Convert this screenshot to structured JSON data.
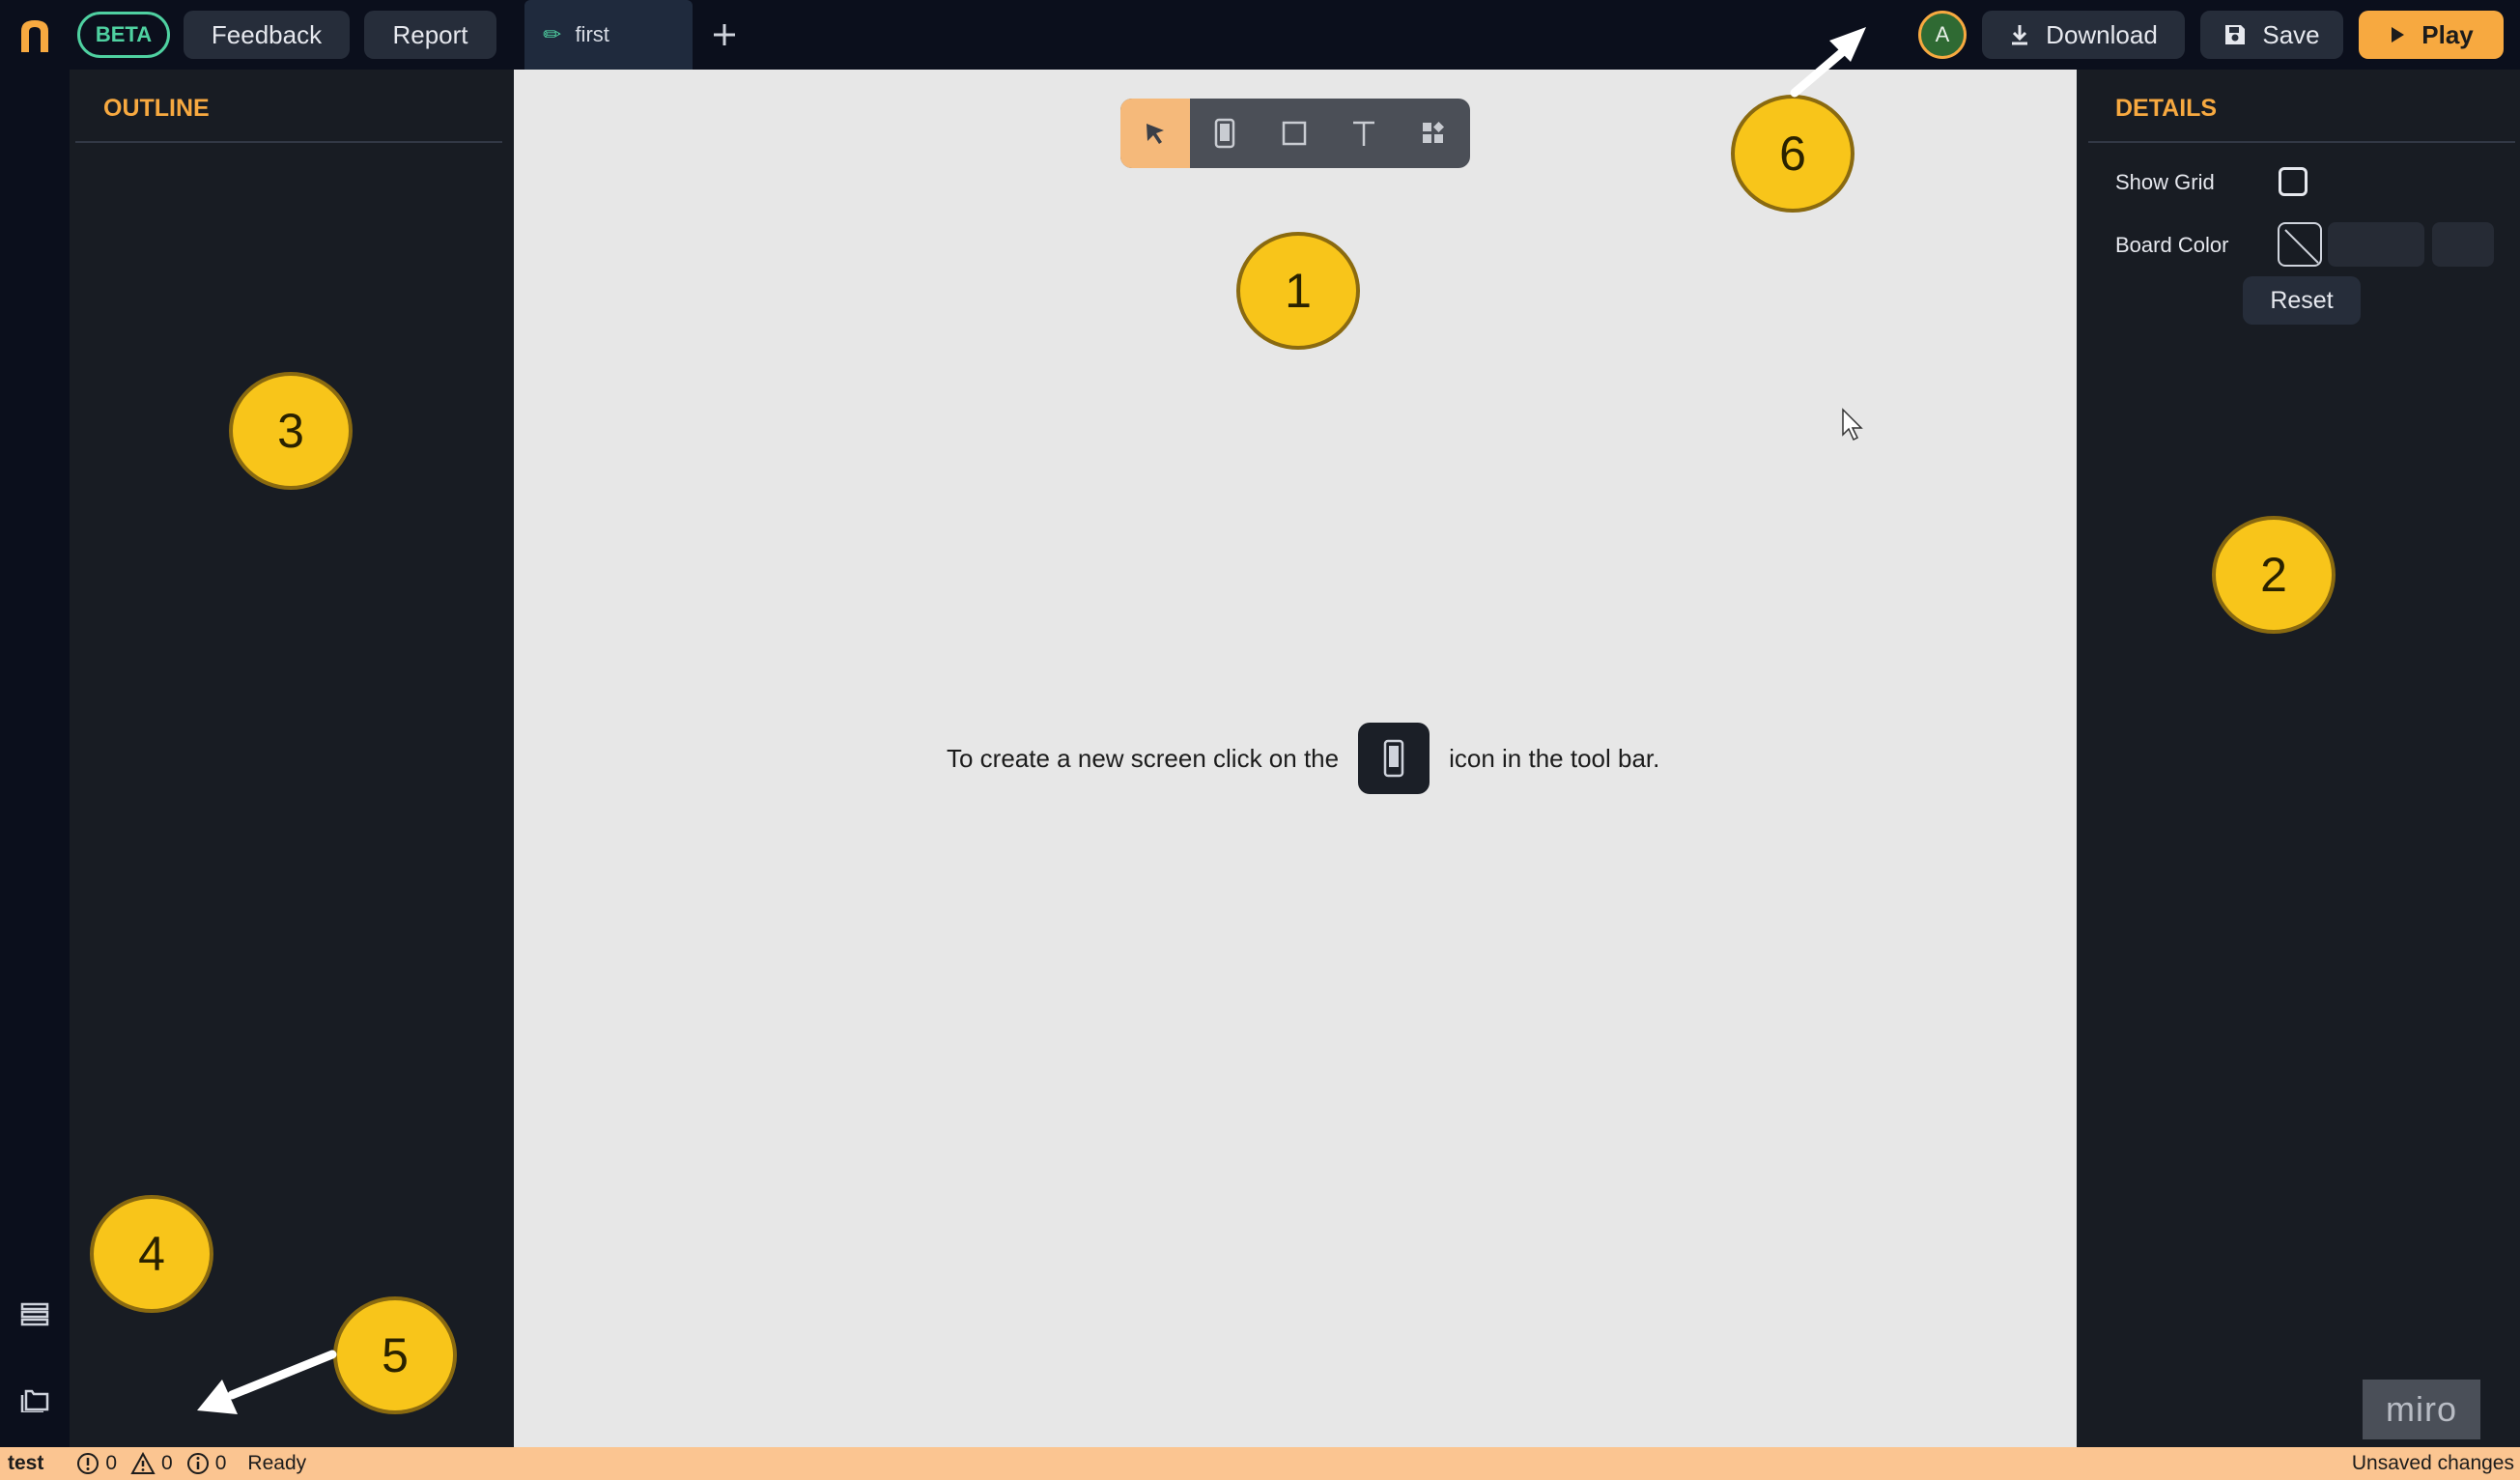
{
  "topbar": {
    "beta_label": "BETA",
    "feedback_label": "Feedback",
    "report_label": "Report",
    "tab_name": "first",
    "avatar_initial": "A",
    "download_label": "Download",
    "save_label": "Save",
    "play_label": "Play"
  },
  "outline": {
    "title": "OUTLINE"
  },
  "canvas": {
    "hint_before": "To create a new screen click on the",
    "hint_after": "icon in the tool bar.",
    "tools": [
      "select-tool",
      "screen-tool",
      "rectangle-tool",
      "text-tool",
      "components-tool"
    ],
    "active_tool": "select-tool"
  },
  "details": {
    "title": "DETAILS",
    "show_grid_label": "Show Grid",
    "show_grid_checked": false,
    "board_color_label": "Board Color",
    "reset_label": "Reset"
  },
  "status": {
    "project": "test",
    "errors": "0",
    "warnings": "0",
    "infos": "0",
    "state": "Ready",
    "save_state": "Unsaved changes"
  },
  "annotations": [
    "1",
    "2",
    "3",
    "4",
    "5",
    "6"
  ],
  "watermark": "miro",
  "colors": {
    "accent": "#f7a940",
    "beta": "#4fd1a1",
    "panel": "#181c23",
    "canvas": "#e7e7e7",
    "marker": "#f8c51a",
    "statusbar": "#fbc591"
  }
}
